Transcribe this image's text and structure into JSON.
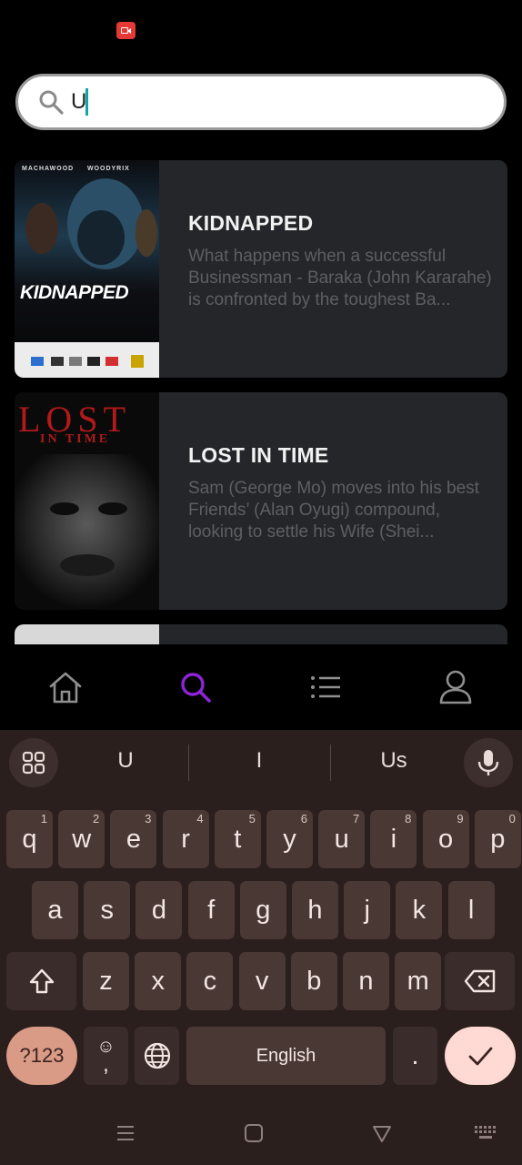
{
  "status": {
    "record_icon": "screen-record-icon"
  },
  "search": {
    "value": "U",
    "placeholder": ""
  },
  "results": [
    {
      "title": "KIDNAPPED",
      "description": "What happens when a successful Businessman - Baraka (John Kararahe) is confronted by the toughest Ba...",
      "poster": {
        "top_text": "MACHAWOOD",
        "top_text_2": "WOODYRIX",
        "title": "KIDNAPPED"
      }
    },
    {
      "title": "LOST IN TIME",
      "description": "Sam (George Mo) moves into his best Friends’ (Alan Oyugi) compound, looking to settle his Wife (Shei...",
      "poster": {
        "title": "LOST",
        "subtitle": "IN TIME"
      }
    }
  ],
  "bottom_nav": {
    "items": [
      {
        "name": "home",
        "icon": "home-icon",
        "active": false
      },
      {
        "name": "search",
        "icon": "search-icon",
        "active": true
      },
      {
        "name": "list",
        "icon": "list-icon",
        "active": false
      },
      {
        "name": "profile",
        "icon": "profile-icon",
        "active": false
      }
    ],
    "active_color": "#8e24d8"
  },
  "keyboard": {
    "suggestions": [
      "U",
      "I",
      "Us"
    ],
    "row1": [
      {
        "k": "q",
        "h": "1"
      },
      {
        "k": "w",
        "h": "2"
      },
      {
        "k": "e",
        "h": "3"
      },
      {
        "k": "r",
        "h": "4"
      },
      {
        "k": "t",
        "h": "5"
      },
      {
        "k": "y",
        "h": "6"
      },
      {
        "k": "u",
        "h": "7"
      },
      {
        "k": "i",
        "h": "8"
      },
      {
        "k": "o",
        "h": "9"
      },
      {
        "k": "p",
        "h": "0"
      }
    ],
    "row2": [
      "a",
      "s",
      "d",
      "f",
      "g",
      "h",
      "j",
      "k",
      "l"
    ],
    "row3": [
      "z",
      "x",
      "c",
      "v",
      "b",
      "n",
      "m"
    ],
    "symbols_label": "?123",
    "emoji_label": "☺",
    "comma_label": ",",
    "space_label": "English",
    "period_label": ".",
    "accent_color": "#ffdad4"
  }
}
